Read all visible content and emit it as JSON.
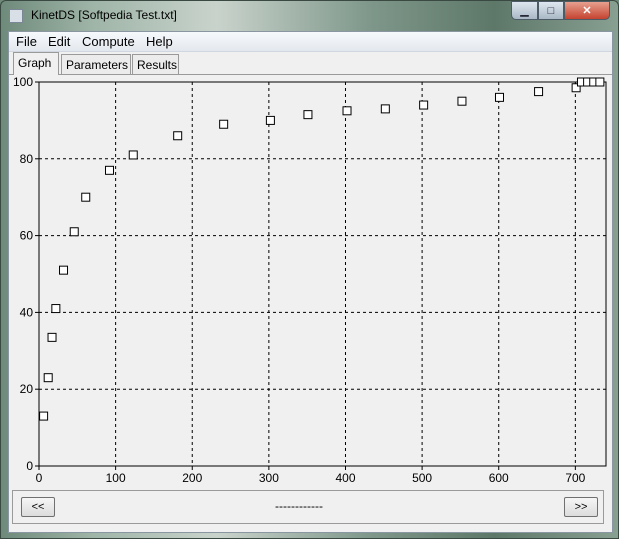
{
  "window": {
    "title": "KinetDS [Softpedia Test.txt]"
  },
  "title_buttons": {
    "minimize": "▁",
    "maximize": "□",
    "close": "✕"
  },
  "menu": [
    "File",
    "Edit",
    "Compute",
    "Help"
  ],
  "tabs": [
    {
      "label": "Graph",
      "active": true
    },
    {
      "label": "Parameters",
      "active": false
    },
    {
      "label": "Results",
      "active": false
    }
  ],
  "navigation": {
    "prev_label": "<<",
    "next_label": ">>",
    "indicator": "------------"
  },
  "chart_data": {
    "type": "scatter",
    "title": "",
    "xlabel": "",
    "ylabel": "",
    "xlim": [
      0,
      740
    ],
    "ylim": [
      0,
      100
    ],
    "x_ticks": [
      0,
      100,
      200,
      300,
      400,
      500,
      600,
      700
    ],
    "y_ticks": [
      0,
      20,
      40,
      60,
      80,
      100
    ],
    "grid": true,
    "marker": "hollow-square",
    "points": [
      {
        "x": 6,
        "y": 13
      },
      {
        "x": 12,
        "y": 23
      },
      {
        "x": 17,
        "y": 33.5
      },
      {
        "x": 22,
        "y": 41
      },
      {
        "x": 32,
        "y": 51
      },
      {
        "x": 46,
        "y": 61
      },
      {
        "x": 61,
        "y": 70
      },
      {
        "x": 92,
        "y": 77
      },
      {
        "x": 123,
        "y": 81
      },
      {
        "x": 181,
        "y": 86
      },
      {
        "x": 241,
        "y": 89
      },
      {
        "x": 302,
        "y": 90
      },
      {
        "x": 351,
        "y": 91.5
      },
      {
        "x": 402,
        "y": 92.5
      },
      {
        "x": 452,
        "y": 93
      },
      {
        "x": 502,
        "y": 94
      },
      {
        "x": 552,
        "y": 95
      },
      {
        "x": 601,
        "y": 96
      },
      {
        "x": 652,
        "y": 97.5
      },
      {
        "x": 701,
        "y": 98.5
      },
      {
        "x": 708,
        "y": 100
      },
      {
        "x": 716,
        "y": 100
      },
      {
        "x": 724,
        "y": 100
      },
      {
        "x": 732,
        "y": 100
      }
    ]
  }
}
